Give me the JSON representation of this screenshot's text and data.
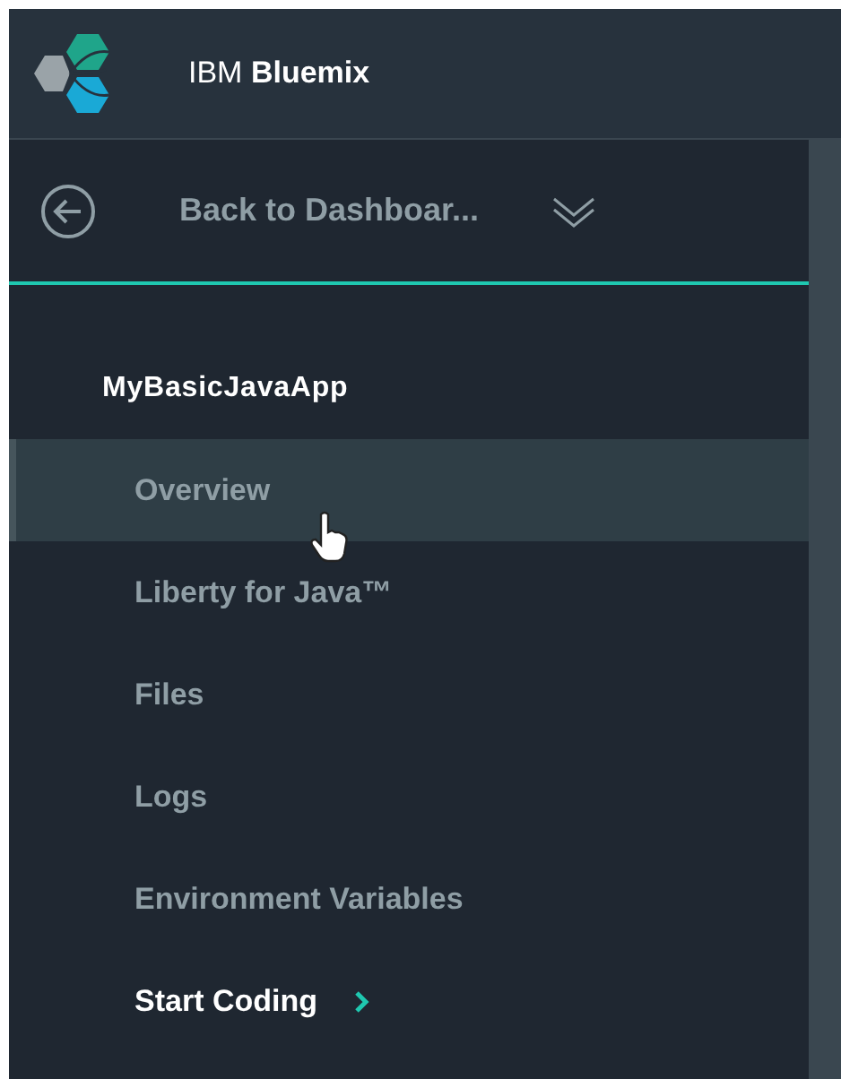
{
  "header": {
    "brand_prefix": "IBM",
    "brand_name": "Bluemix"
  },
  "back": {
    "label": "Back to Dashboar..."
  },
  "app": {
    "name": "MyBasicJavaApp"
  },
  "nav": [
    {
      "label": "Overview",
      "kind": "link",
      "selected": true
    },
    {
      "label": "Liberty for Java™",
      "kind": "link",
      "selected": false
    },
    {
      "label": "Files",
      "kind": "link",
      "selected": false
    },
    {
      "label": "Logs",
      "kind": "link",
      "selected": false
    },
    {
      "label": "Environment Variables",
      "kind": "link",
      "selected": false
    },
    {
      "label": "Start Coding",
      "kind": "action",
      "selected": false
    }
  ]
}
